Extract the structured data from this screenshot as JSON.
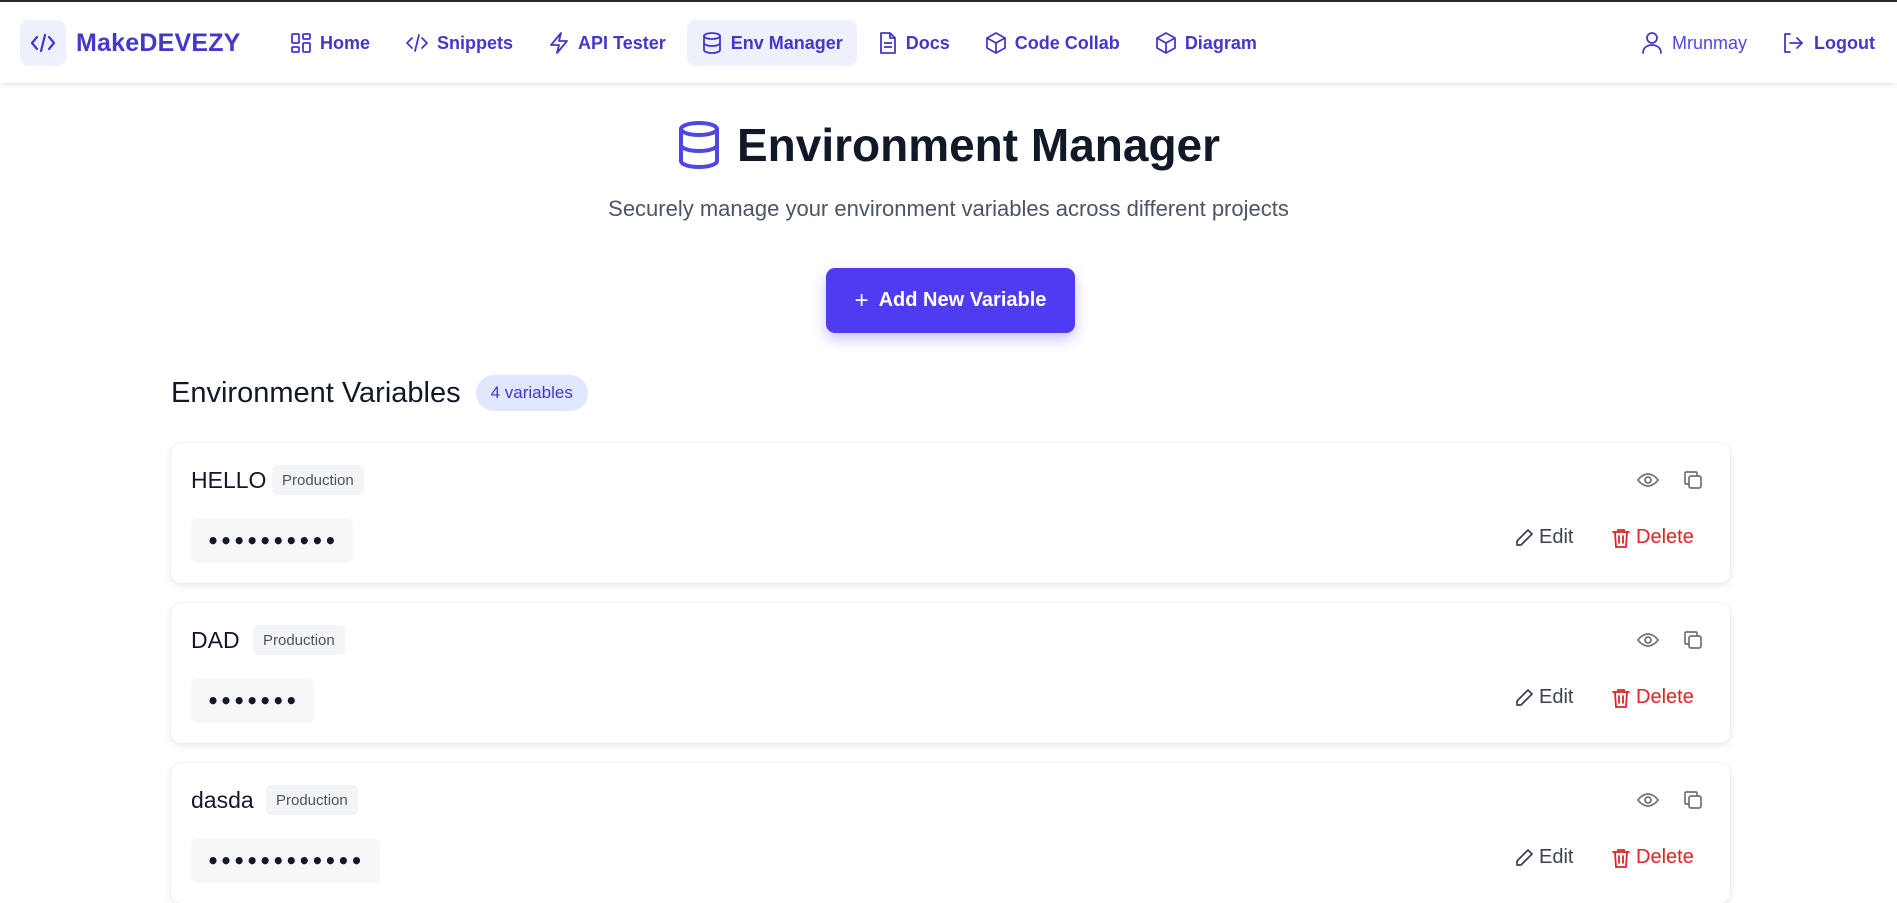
{
  "brand": {
    "name": "MakeDEVEZY",
    "icon": "code-icon"
  },
  "nav": {
    "items": [
      {
        "label": "Home",
        "icon": "grid-icon"
      },
      {
        "label": "Snippets",
        "icon": "code-icon"
      },
      {
        "label": "API Tester",
        "icon": "bolt-icon"
      },
      {
        "label": "Env Manager",
        "icon": "database-icon",
        "active": true
      },
      {
        "label": "Docs",
        "icon": "document-icon"
      },
      {
        "label": "Code Collab",
        "icon": "cube-icon"
      },
      {
        "label": "Diagram",
        "icon": "cube-icon"
      }
    ],
    "user": "Mrunmay",
    "logout": "Logout"
  },
  "header": {
    "title": "Environment Manager",
    "subtitle": "Securely manage your environment variables across different projects",
    "add_button": "Add New Variable",
    "add_icon": "+"
  },
  "section": {
    "title": "Environment Variables",
    "count": "4 variables"
  },
  "variables": [
    {
      "name": "HELLO",
      "env": "Production",
      "masked": "••••••••••",
      "edit": "Edit",
      "delete": "Delete"
    },
    {
      "name": "DAD",
      "env": "Production",
      "masked": "•••••••",
      "edit": "Edit",
      "delete": "Delete"
    },
    {
      "name": "dasda",
      "env": "Production",
      "masked": "••••••••••••",
      "edit": "Edit",
      "delete": "Delete"
    }
  ],
  "colors": {
    "accent": "#4f3bf0",
    "nav_text": "#4338ca",
    "delete": "#dc2626",
    "badge_bg": "#e0e7ff"
  }
}
